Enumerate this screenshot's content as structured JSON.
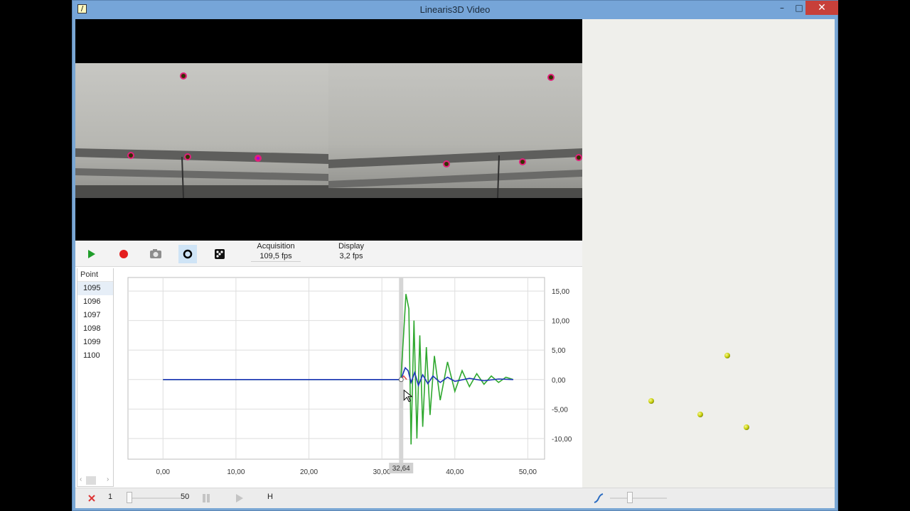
{
  "window": {
    "title": "Linearis3D Video",
    "minimize": "–",
    "maximize": "□",
    "close": "✕"
  },
  "toolbar": {
    "acquisition_label": "Acquisition",
    "acquisition_value": "109,5 fps",
    "display_label": "Display",
    "display_value": "3,2 fps",
    "icons": [
      "play-icon",
      "record-icon",
      "camera-icon",
      "circle-icon",
      "dice-icon"
    ]
  },
  "points": {
    "header": "Point",
    "items": [
      "1095",
      "1096",
      "1097",
      "1098",
      "1099",
      "1100"
    ],
    "selected": "1095"
  },
  "chart_data": {
    "type": "line",
    "title": "",
    "xlabel": "",
    "ylabel": "",
    "x_ticks": [
      "0,00",
      "10,00",
      "20,00",
      "30,00",
      "40,00",
      "50,00"
    ],
    "y_ticks": [
      "15,00",
      "10,00",
      "5,00",
      "0,00",
      "-5,00",
      "-10,00"
    ],
    "xlim": [
      -4.8,
      52.3
    ],
    "ylim": [
      -13.5,
      17.3
    ],
    "grid": true,
    "cursor_x": 32.64,
    "cursor_label": "32,64",
    "series": [
      {
        "color": "#2fa82f",
        "x": [
          0,
          10,
          20,
          30,
          32.6,
          33.0,
          33.3,
          33.7,
          34.0,
          34.4,
          34.8,
          35.2,
          35.6,
          36.1,
          36.6,
          37.2,
          38.0,
          39.0,
          40.0,
          41.0,
          42.0,
          43.0,
          44.0,
          45.0,
          46.0,
          47.0,
          48.0
        ],
        "values": [
          0,
          0,
          0,
          0,
          0,
          8,
          14.5,
          12,
          -11,
          10,
          -10,
          7.5,
          -8,
          5.5,
          -6,
          4,
          -3.5,
          3,
          -2,
          1.5,
          -1.2,
          1,
          -0.8,
          0.6,
          -0.5,
          0.4,
          0
        ]
      },
      {
        "color": "#1c34b8",
        "x": [
          0,
          10,
          20,
          30,
          32.6,
          33.2,
          33.6,
          34.0,
          34.5,
          35.0,
          35.6,
          36.3,
          37.0,
          38.0,
          39.0,
          40.0,
          42.0,
          44.0,
          46.0,
          48.0
        ],
        "values": [
          0,
          0,
          0,
          0,
          0,
          2,
          1.5,
          -0.5,
          1.2,
          -1,
          0.8,
          -0.7,
          0.6,
          -0.5,
          0.4,
          -0.3,
          0.2,
          -0.2,
          0.1,
          0
        ]
      },
      {
        "color": "#e05050",
        "x": [
          32.6,
          33.0,
          33.4
        ],
        "values": [
          0,
          0.6,
          0
        ]
      }
    ]
  },
  "bottombar": {
    "frame_start": "1",
    "frame_step": "50",
    "mode_label": "H",
    "icons": [
      "delete-icon",
      "pause-icon",
      "play-icon",
      "curve-icon"
    ]
  },
  "scene3d": {
    "points": [
      {
        "color": "#cdd40c"
      },
      {
        "color": "#cdd40c"
      },
      {
        "color": "#cdd40c"
      },
      {
        "color": "#cdd40c"
      }
    ]
  }
}
